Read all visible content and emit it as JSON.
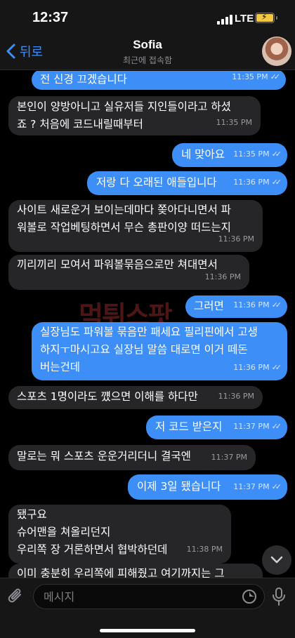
{
  "status": {
    "time": "12:37",
    "network": "LTE"
  },
  "header": {
    "back_label": "뒤로",
    "contact_name": "Sofia",
    "last_seen": "최근에 접속함"
  },
  "messages": [
    {
      "dir": "out",
      "text": "전 신경 끄겠습니다",
      "time": "11:35 PM",
      "read": true
    },
    {
      "dir": "in",
      "lines": [
        "본인이 양방아니고 실유저들 지인들이라고 하셨",
        "죠 ? 처음에 코드내릴때부터"
      ],
      "time": "11:35 PM"
    },
    {
      "dir": "out",
      "text": "네 맞아요",
      "time": "11:35 PM",
      "read": true
    },
    {
      "dir": "out",
      "text": "저랑 다 오래된 애들입니다",
      "time": "11:36 PM",
      "read": true
    },
    {
      "dir": "in",
      "lines": [
        "사이트 새로운거 보이는데마다 쫒아다니면서 파",
        "워볼로 작업베팅하면서 무슨 총판이양 떠드는지"
      ],
      "time": "11:36 PM"
    },
    {
      "dir": "in",
      "text": "끼리끼리 모여서 파워볼묶음으로만 쳐대면서",
      "time": "11:36 PM"
    },
    {
      "dir": "out",
      "text": "그러면",
      "time": "11:36 PM",
      "read": true
    },
    {
      "dir": "out",
      "lines": [
        "실장님도 파워볼 묶음만 패세요 필리핀에서 고생",
        "하지ㅜ마시고요 실장님 말씀 대로면 이거 떼돈",
        "버는건데"
      ],
      "time": "11:36 PM",
      "read": true
    },
    {
      "dir": "in",
      "text": "스포츠 1명이라도 꺴으면 이해를 하다만",
      "time": "11:36 PM"
    },
    {
      "dir": "out",
      "text": "저 코드 받은지",
      "time": "11:37 PM",
      "read": true
    },
    {
      "dir": "in",
      "text": "말로는 뭐 스포츠 운운거리더니 결국엔",
      "time": "11:37 PM"
    },
    {
      "dir": "out",
      "text": "이제 3일 됐습니다",
      "time": "11:37 PM",
      "read": true
    },
    {
      "dir": "in",
      "lines": [
        "됐구요",
        "슈어맨을 쳐올리던지",
        "우리쪽 장 거론하면서 협박하던데"
      ],
      "time": "11:38 PM"
    },
    {
      "dir": "in",
      "text": "이미 충분히 우리쪽에 피해줬고 여기까지는 그",
      "time": ""
    }
  ],
  "watermark": "먹튀스팟",
  "input": {
    "placeholder": "메시지"
  },
  "colors": {
    "accent": "#3e8ef7",
    "incoming_bubble": "#262628",
    "background": "#000000",
    "battery": "#f2c744"
  },
  "icons": [
    "chevron-left-icon",
    "attach-icon",
    "sticker-icon",
    "mic-icon",
    "chevron-down-icon",
    "read-ticks-icon"
  ]
}
